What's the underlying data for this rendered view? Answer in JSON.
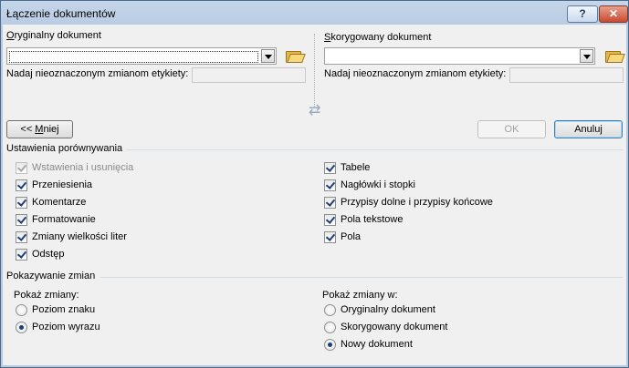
{
  "window": {
    "title": "Łączenie dokumentów",
    "help_label": "?",
    "close_label": "✕"
  },
  "original": {
    "label_first": "O",
    "label_rest": "ryginalny dokument",
    "tag_label": "Nadaj nieoznaczonym zmianom etykiety:"
  },
  "revised": {
    "label_first": "S",
    "label_rest": "korygowany dokument",
    "tag_label": "Nadaj nieoznaczonym zmianom etykiety:"
  },
  "buttons": {
    "less_prefix": "<< ",
    "less_first": "M",
    "less_rest": "niej",
    "ok": "OK",
    "cancel": "Anuluj"
  },
  "comparison": {
    "title": "Ustawienia porównywania",
    "left": [
      {
        "label": "Wstawienia i usunięcia",
        "checked": true,
        "disabled": true
      },
      {
        "label": "Przeniesienia",
        "checked": true
      },
      {
        "label": "Komentarze",
        "checked": true
      },
      {
        "label": "Formatowanie",
        "checked": true
      },
      {
        "label": "Zmiany wielkości liter",
        "checked": true
      },
      {
        "label": "Odstęp",
        "checked": true
      }
    ],
    "right": [
      {
        "label": "Tabele",
        "checked": true
      },
      {
        "label": "Nagłówki i stopki",
        "checked": true
      },
      {
        "label": "Przypisy dolne i przypisy końcowe",
        "checked": true
      },
      {
        "label": "Pola tekstowe",
        "checked": true
      },
      {
        "label": "Pola",
        "checked": true
      }
    ]
  },
  "show_changes": {
    "title": "Pokazywanie zmian",
    "level_label": "Pokaż zmiany:",
    "level_options": [
      {
        "label": "Poziom znaku",
        "checked": false
      },
      {
        "label": "Poziom wyrazu",
        "checked": true
      }
    ],
    "in_label": "Pokaż zmiany w:",
    "in_options": [
      {
        "label": "Oryginalny dokument",
        "checked": false
      },
      {
        "label": "Skorygowany dokument",
        "checked": false
      },
      {
        "label": "Nowy dokument",
        "checked": true
      }
    ]
  }
}
